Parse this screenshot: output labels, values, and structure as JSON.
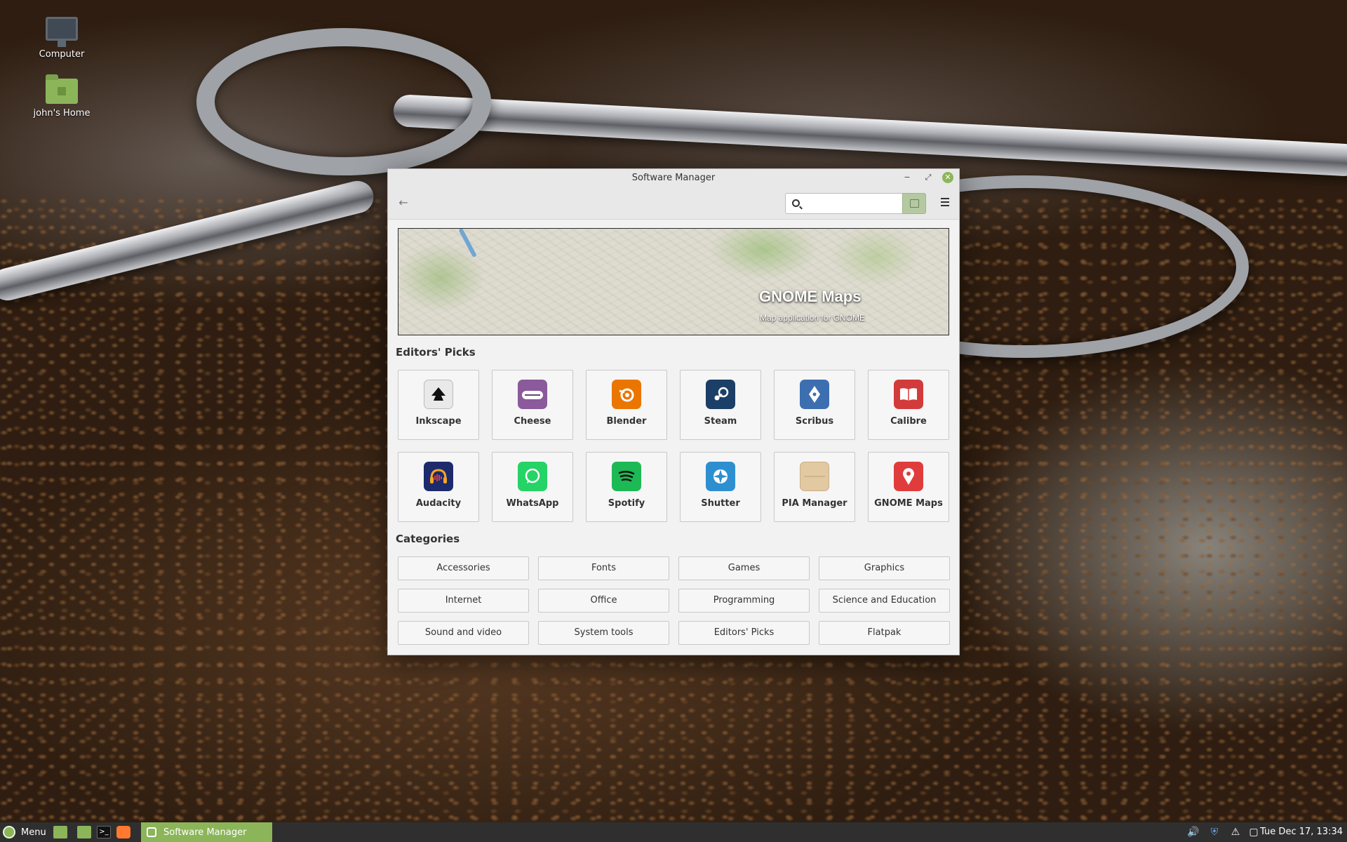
{
  "desktop": {
    "icons": [
      {
        "label": "Computer"
      },
      {
        "label": "john's Home"
      }
    ]
  },
  "window": {
    "title": "Software Manager",
    "search": {
      "value": "",
      "placeholder": ""
    },
    "banner": {
      "title": "GNOME Maps",
      "subtitle": "Map application for GNOME"
    },
    "editors_picks": {
      "heading": "Editors' Picks",
      "apps": [
        {
          "name": "Inkscape",
          "icon": "inkscape-icon",
          "color": "#e9e9e9"
        },
        {
          "name": "Cheese",
          "icon": "cheese-icon",
          "color": "#8a5a9a"
        },
        {
          "name": "Blender",
          "icon": "blender-icon",
          "color": "#ea7600"
        },
        {
          "name": "Steam",
          "icon": "steam-icon",
          "color": "#1b3f66"
        },
        {
          "name": "Scribus",
          "icon": "scribus-icon",
          "color": "#3d6fb0"
        },
        {
          "name": "Calibre",
          "icon": "calibre-icon",
          "color": "#d23b3b"
        },
        {
          "name": "Audacity",
          "icon": "audacity-icon",
          "color": "#1d2a6b"
        },
        {
          "name": "WhatsApp",
          "icon": "whatsapp-icon",
          "color": "#25d366"
        },
        {
          "name": "Spotify",
          "icon": "spotify-icon",
          "color": "#1db954"
        },
        {
          "name": "Shutter",
          "icon": "shutter-icon",
          "color": "#2e8fd0"
        },
        {
          "name": "PIA Manager",
          "icon": "pia-manager-icon",
          "color": "#e3c9a2"
        },
        {
          "name": "GNOME Maps",
          "icon": "gnome-maps-icon",
          "color": "#e03c3c"
        }
      ]
    },
    "categories": {
      "heading": "Categories",
      "items": [
        "Accessories",
        "Fonts",
        "Games",
        "Graphics",
        "Internet",
        "Office",
        "Programming",
        "Science and Education",
        "Sound and video",
        "System tools",
        "Editors' Picks",
        "Flatpak"
      ]
    }
  },
  "taskbar": {
    "menu_label": "Menu",
    "active_task": "Software Manager",
    "clock": "Tue Dec 17, 13:34"
  },
  "colors": {
    "accent": "#8cb55a",
    "taskbar": "#2f2f2f"
  }
}
